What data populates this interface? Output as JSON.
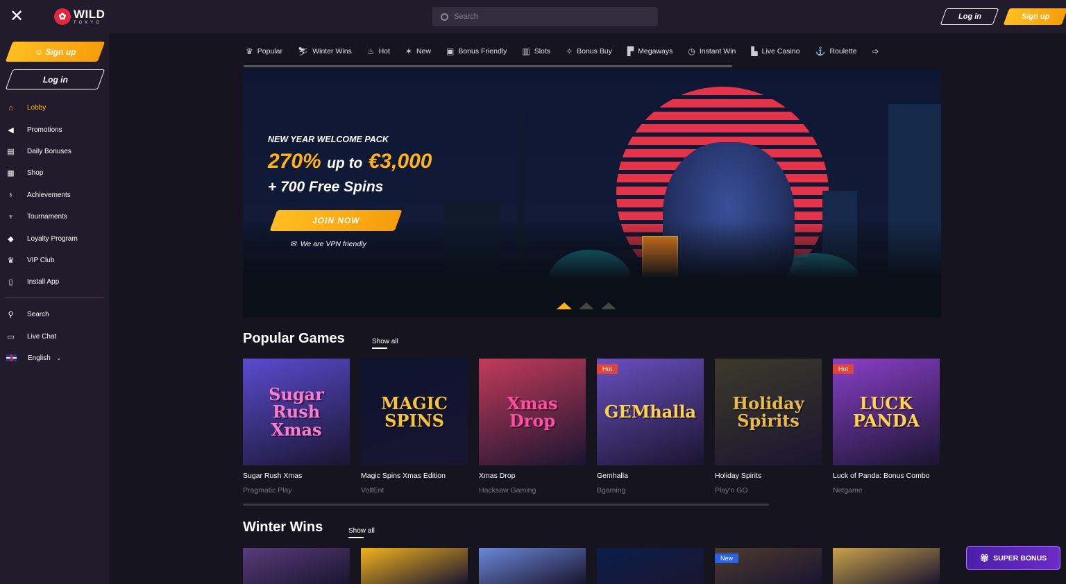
{
  "topbar": {
    "close_icon": "close-icon",
    "logo_main": "WILD",
    "logo_sub": "TOKYO",
    "search_placeholder": "Search",
    "login_label": "Log in",
    "signup_label": "Sign up"
  },
  "sidebar": {
    "signup_label": "Sign up",
    "login_label": "Log in",
    "items": [
      {
        "label": "Lobby",
        "icon": "home-icon"
      },
      {
        "label": "Promotions",
        "icon": "megaphone-icon"
      },
      {
        "label": "Daily Bonuses",
        "icon": "calendar-icon"
      },
      {
        "label": "Shop",
        "icon": "shop-icon"
      },
      {
        "label": "Achievements",
        "icon": "ribbon-icon"
      },
      {
        "label": "Tournaments",
        "icon": "trophy-icon"
      },
      {
        "label": "Loyalty Program",
        "icon": "diamond-icon"
      },
      {
        "label": "VIP Club",
        "icon": "crown-icon"
      },
      {
        "label": "Install App",
        "icon": "phone-icon"
      }
    ],
    "bottom_items": [
      {
        "label": "Search",
        "icon": "search-icon"
      },
      {
        "label": "Live Chat",
        "icon": "chat-icon"
      },
      {
        "label": "English",
        "icon": "uk-flag-icon"
      }
    ]
  },
  "categories": [
    {
      "label": "Popular",
      "icon": "crown-icon"
    },
    {
      "label": "Winter Wins",
      "icon": "ski-icon"
    },
    {
      "label": "Hot",
      "icon": "flame-icon"
    },
    {
      "label": "New",
      "icon": "new-icon"
    },
    {
      "label": "Bonus Friendly",
      "icon": "gift-icon"
    },
    {
      "label": "Slots",
      "icon": "slot-machine-icon"
    },
    {
      "label": "Bonus Buy",
      "icon": "bonus-buy-icon"
    },
    {
      "label": "Megaways",
      "icon": "megaways-icon"
    },
    {
      "label": "Instant Win",
      "icon": "stopwatch-icon"
    },
    {
      "label": "Live Casino",
      "icon": "live-casino-icon"
    },
    {
      "label": "Roulette",
      "icon": "roulette-icon"
    }
  ],
  "hero": {
    "kicker": "NEW YEAR WELCOME PACK",
    "title_percent": "270%",
    "title_upto": "up to",
    "title_amount": "€3,000",
    "subtitle": "+ 700 Free Spins",
    "cta_label": "JOIN NOW",
    "vpn_text": "We are VPN friendly",
    "active_slide": 1,
    "slide_count": 3
  },
  "popular": {
    "title": "Popular Games",
    "show_all": "Show all",
    "games": [
      {
        "name": "Sugar Rush Xmas",
        "provider": "Pragmatic Play",
        "art": "Sugar Rush Xmas",
        "badge": "",
        "bg": "#5b4bd0",
        "fg": "#ff7ac9"
      },
      {
        "name": "Magic Spins Xmas Edition",
        "provider": "VoltEnt",
        "art": "MAGIC SPINS",
        "badge": "",
        "bg": "#0c1430",
        "fg": "#f6c43a"
      },
      {
        "name": "Xmas Drop",
        "provider": "Hacksaw Gaming",
        "art": "Xmas Drop",
        "badge": "",
        "bg": "#c23b5a",
        "fg": "#ff4fa3"
      },
      {
        "name": "Gemhalla",
        "provider": "Bgaming",
        "art": "GEMhalla",
        "badge": "Hot",
        "bg": "#6a4fc0",
        "fg": "#ffd24a"
      },
      {
        "name": "Holiday Spirits",
        "provider": "Play'n GO",
        "art": "Holiday Spirits",
        "badge": "",
        "bg": "#3c3a2a",
        "fg": "#e7b94c"
      },
      {
        "name": "Luck of Panda: Bonus Combo",
        "provider": "Netgame",
        "art": "LUCK PANDA",
        "badge": "Hot",
        "bg": "#8a3fc8",
        "fg": "#ffd54a"
      }
    ]
  },
  "winter": {
    "title": "Winter Wins",
    "show_all": "Show all",
    "games": [
      {
        "badge": "",
        "bg": "#5a3b7a"
      },
      {
        "badge": "",
        "bg": "#f2b21c"
      },
      {
        "badge": "",
        "bg": "#6b88d8"
      },
      {
        "badge": "",
        "bg": "#0b1e4a"
      },
      {
        "badge": "New",
        "bg": "#4e3a2e"
      },
      {
        "badge": "",
        "bg": "#c9a24a"
      }
    ]
  },
  "super_bonus": {
    "label": "SUPER BONUS",
    "icon": "gift-icon"
  },
  "colors": {
    "accent": "#ffb416",
    "background": "#16141f",
    "sidebar": "#221b2b"
  }
}
